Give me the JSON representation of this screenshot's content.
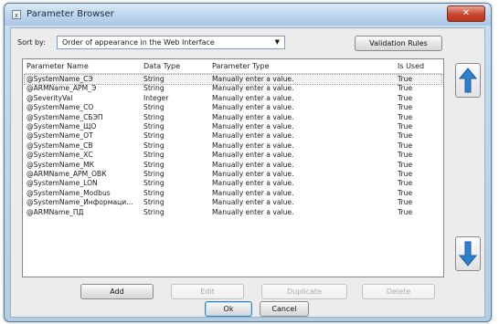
{
  "window": {
    "title": "Parameter Browser",
    "icon_glyph": "x",
    "close_glyph": "✕"
  },
  "sort": {
    "label": "Sort by:",
    "value": "Order of appearance in the Web Interface",
    "arrow_glyph": "▼"
  },
  "buttons": {
    "validation_rules": "Validation Rules",
    "add": "Add",
    "edit": "Edit",
    "duplicate": "Duplicate",
    "delete": "Delete",
    "ok": "Ok",
    "cancel": "Cancel"
  },
  "table": {
    "columns": [
      "Parameter Name",
      "Data Type",
      "Parameter Type",
      "Is Used"
    ],
    "rows": [
      [
        "@SystemName_СЭ",
        "String",
        "Manually enter a value.",
        "True"
      ],
      [
        "@ARMName_АРМ_Э",
        "String",
        "Manually enter a value.",
        "True"
      ],
      [
        "@SeverityVal",
        "Integer",
        "Manually enter a value.",
        "True"
      ],
      [
        "@SystemName_СО",
        "String",
        "Manually enter a value.",
        "True"
      ],
      [
        "@SystemName_СБЭП",
        "String",
        "Manually enter a value.",
        "True"
      ],
      [
        "@SystemName_ЩО",
        "String",
        "Manually enter a value.",
        "True"
      ],
      [
        "@SystemName_ОТ",
        "String",
        "Manually enter a value.",
        "True"
      ],
      [
        "@SystemName_СВ",
        "String",
        "Manually enter a value.",
        "True"
      ],
      [
        "@SystemName_ХС",
        "String",
        "Manually enter a value.",
        "True"
      ],
      [
        "@SystemName_МК",
        "String",
        "Manually enter a value.",
        "True"
      ],
      [
        "@ARMName_АРМ_ОВК",
        "String",
        "Manually enter a value.",
        "True"
      ],
      [
        "@SystemName_LON",
        "String",
        "Manually enter a value.",
        "True"
      ],
      [
        "@SystemName_Modbus",
        "String",
        "Manually enter a value.",
        "True"
      ],
      [
        "@SystemName_Информаци...",
        "String",
        "Manually enter a value.",
        "True"
      ],
      [
        "@ARMName_ПД",
        "String",
        "Manually enter a value.",
        "True"
      ]
    ]
  },
  "colors": {
    "arrow_blue": "#2f7fcf",
    "arrow_dark": "#1b5aa3"
  },
  "icons": {
    "up": "arrow-up-icon",
    "down": "arrow-down-icon"
  }
}
